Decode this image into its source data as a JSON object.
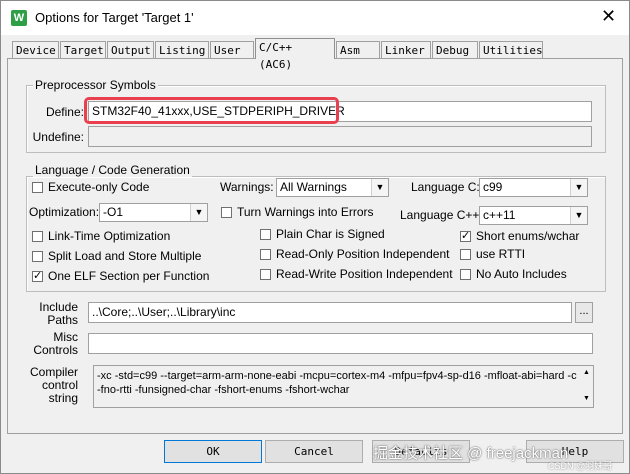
{
  "window": {
    "title": "Options for Target 'Target 1'",
    "app_icon": "W",
    "close_glyph": "✕"
  },
  "tabs": [
    "Device",
    "Target",
    "Output",
    "Listing",
    "User",
    "C/C++ (AC6)",
    "Asm",
    "Linker",
    "Debug",
    "Utilities"
  ],
  "preprocessor": {
    "group_label": "Preprocessor Symbols",
    "define_label": "Define:",
    "define_value": "STM32F40_41xxx,USE_STDPERIPH_DRIVER",
    "undefine_label": "Undefine:",
    "undefine_value": ""
  },
  "language": {
    "group_label": "Language / Code Generation",
    "execute_only": {
      "label": "Execute-only Code",
      "checked": false
    },
    "warnings_label": "Warnings:",
    "warnings_value": "All Warnings",
    "language_c_label": "Language C:",
    "language_c_value": "c99",
    "optimization_label": "Optimization:",
    "optimization_value": "-O1",
    "turn_warnings_errors": {
      "label": "Turn Warnings into Errors",
      "checked": false
    },
    "language_cpp_label": "Language C++:",
    "language_cpp_value": "c++11",
    "link_time": {
      "label": "Link-Time Optimization",
      "checked": false
    },
    "plain_char": {
      "label": "Plain Char is Signed",
      "checked": false
    },
    "short_enums": {
      "label": "Short enums/wchar",
      "checked": true
    },
    "split_load": {
      "label": "Split Load and Store Multiple",
      "checked": false
    },
    "ro_pi": {
      "label": "Read-Only Position Independent",
      "checked": false
    },
    "use_rtti": {
      "label": "use RTTI",
      "checked": false
    },
    "one_elf": {
      "label": "One ELF Section per Function",
      "checked": true
    },
    "rw_pi": {
      "label": "Read-Write Position Independent",
      "checked": false
    },
    "no_auto_includes": {
      "label": "No Auto Includes",
      "checked": false
    }
  },
  "include": {
    "label_line1": "Include",
    "label_line2": "Paths",
    "value": "..\\Core;..\\User;..\\Library\\inc",
    "browse_label": "..."
  },
  "misc": {
    "label_line1": "Misc",
    "label_line2": "Controls",
    "value": ""
  },
  "compiler": {
    "label_line1": "Compiler",
    "label_line2": "control",
    "label_line3": "string",
    "line1": "-xc -std=c99 --target=arm-arm-none-eabi -mcpu=cortex-m4 -mfpu=fpv4-sp-d16 -mfloat-abi=hard -c",
    "line2": "-fno-rtti -funsigned-char -fshort-enums -fshort-wchar"
  },
  "buttons": {
    "ok": "OK",
    "cancel": "Cancel",
    "defaults": "Defaults",
    "help": "Help"
  },
  "watermark": {
    "main": "掘金技术社区 @ freejackman",
    "sub": "CSDN @羽妹哥"
  }
}
